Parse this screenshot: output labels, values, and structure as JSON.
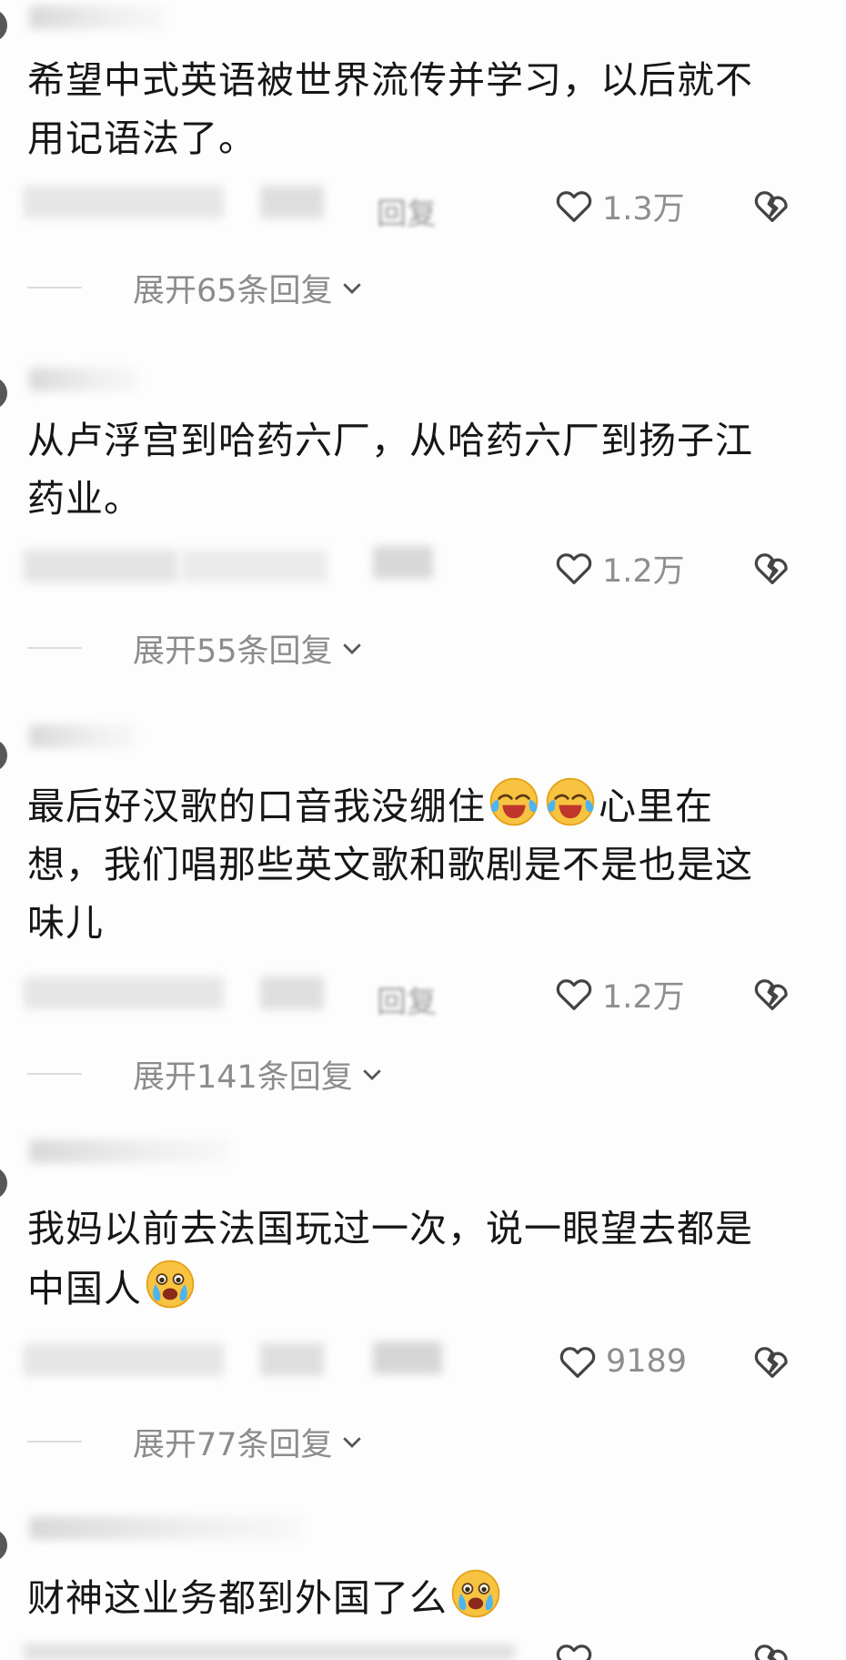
{
  "comments": [
    {
      "text": "希望中式英语被世界流传并学习，以后就不用记语法了。",
      "likes": "1.3万",
      "expand_label": "展开65条回复"
    },
    {
      "text": "从卢浮宫到哈药六厂，从哈药六厂到扬子江药业。",
      "likes": "1.2万",
      "expand_label": "展开55条回复"
    },
    {
      "text_before": "最后好汉歌的口音我没绷住",
      "text_after": "心里在想，我们唱那些英文歌和歌剧是不是也是这味儿",
      "emoji_icon": "laughing-crying-emoji-icon",
      "likes": "1.2万",
      "expand_label": "展开141条回复"
    },
    {
      "text": "我妈以前去法国玩过一次，说一眼望去都是中国人",
      "emoji_icon": "crying-emoji-icon",
      "likes": "9189",
      "expand_label": "展开77条回复"
    },
    {
      "text": "财神这业务都到外国了么",
      "emoji_icon": "crying-emoji-icon"
    }
  ],
  "ui": {
    "reply_label": "回复",
    "like_icon": "heart-outline-icon",
    "dislike_icon": "broken-heart-icon",
    "expand_icon": "chevron-down-icon",
    "text_color": "#161616",
    "muted_color": "#8c8c8c"
  }
}
